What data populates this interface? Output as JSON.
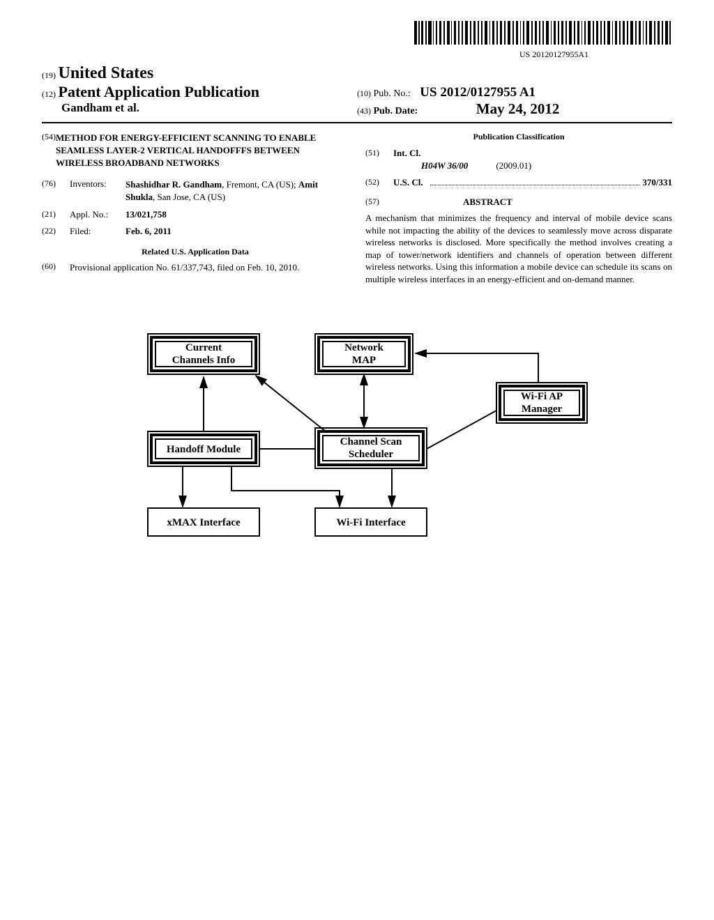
{
  "barcode_text": "US 20120127955A1",
  "header": {
    "country_code": "(19)",
    "country": "United States",
    "pub_type_code": "(12)",
    "pub_type": "Patent Application Publication",
    "authors": "Gandham et al.",
    "pub_no_code": "(10)",
    "pub_no_label": "Pub. No.:",
    "pub_no": "US 2012/0127955 A1",
    "pub_date_code": "(43)",
    "pub_date_label": "Pub. Date:",
    "pub_date": "May 24, 2012"
  },
  "left": {
    "title_code": "(54)",
    "title": "METHOD FOR ENERGY-EFFICIENT SCANNING TO ENABLE SEAMLESS LAYER-2 VERTICAL HANDOFFFS BETWEEN WIRELESS BROADBAND NETWORKS",
    "inventors_code": "(76)",
    "inventors_label": "Inventors:",
    "inventors_name1": "Shashidhar R. Gandham",
    "inventors_loc1": ", Fremont, CA (US); ",
    "inventors_name2": "Amit Shukla",
    "inventors_loc2": ", San Jose, CA (US)",
    "appl_code": "(21)",
    "appl_label": "Appl. No.:",
    "appl_value": "13/021,758",
    "filed_code": "(22)",
    "filed_label": "Filed:",
    "filed_value": "Feb. 6, 2011",
    "related_title": "Related U.S. Application Data",
    "prov_code": "(60)",
    "prov_text": "Provisional application No. 61/337,743, filed on Feb. 10, 2010."
  },
  "right": {
    "pub_class_title": "Publication Classification",
    "intcl_code": "(51)",
    "intcl_label": "Int. Cl.",
    "intcl_value": "H04W 36/00",
    "intcl_date": "(2009.01)",
    "uscl_code": "(52)",
    "uscl_label": "U.S. Cl.",
    "uscl_value": "370/331",
    "abstract_code": "(57)",
    "abstract_label": "ABSTRACT",
    "abstract_text": "A mechanism that minimizes the frequency and interval of mobile device scans while not impacting the ability of the devices to seamlessly move across disparate wireless networks is disclosed. More specifically the method involves creating a map of tower/network identifiers and channels of operation between different wireless networks. Using this information a mobile device can schedule its scans on multiple wireless interfaces in an energy-efficient and on-demand manner."
  },
  "diagram": {
    "box1_l1": "Current",
    "box1_l2": "Channels Info",
    "box2_l1": "Network",
    "box2_l2": "MAP",
    "box3_l1": "Wi-Fi AP",
    "box3_l2": "Manager",
    "box4": "Handoff Module",
    "box5_l1": "Channel Scan",
    "box5_l2": "Scheduler",
    "box6": "xMAX Interface",
    "box7": "Wi-Fi Interface"
  },
  "chart_data": {
    "type": "diagram",
    "nodes": [
      {
        "id": "current_channels",
        "label": "Current Channels Info"
      },
      {
        "id": "network_map",
        "label": "Network MAP"
      },
      {
        "id": "wifi_ap_manager",
        "label": "Wi-Fi AP Manager"
      },
      {
        "id": "handoff_module",
        "label": "Handoff Module"
      },
      {
        "id": "channel_scan_scheduler",
        "label": "Channel Scan Scheduler"
      },
      {
        "id": "xmax_interface",
        "label": "xMAX Interface"
      },
      {
        "id": "wifi_interface",
        "label": "Wi-Fi Interface"
      }
    ],
    "edges": [
      {
        "from": "handoff_module",
        "to": "current_channels",
        "dir": "to"
      },
      {
        "from": "network_map",
        "to": "channel_scan_scheduler",
        "dir": "both"
      },
      {
        "from": "wifi_ap_manager",
        "to": "network_map",
        "dir": "to"
      },
      {
        "from": "channel_scan_scheduler",
        "to": "current_channels",
        "dir": "to"
      },
      {
        "from": "handoff_module",
        "to": "channel_scan_scheduler",
        "dir": "line"
      },
      {
        "from": "handoff_module",
        "to": "xmax_interface",
        "dir": "to"
      },
      {
        "from": "handoff_module",
        "to": "wifi_interface",
        "dir": "to"
      },
      {
        "from": "channel_scan_scheduler",
        "to": "wifi_interface",
        "dir": "to"
      },
      {
        "from": "wifi_ap_manager",
        "to": "channel_scan_scheduler",
        "dir": "line"
      }
    ]
  }
}
